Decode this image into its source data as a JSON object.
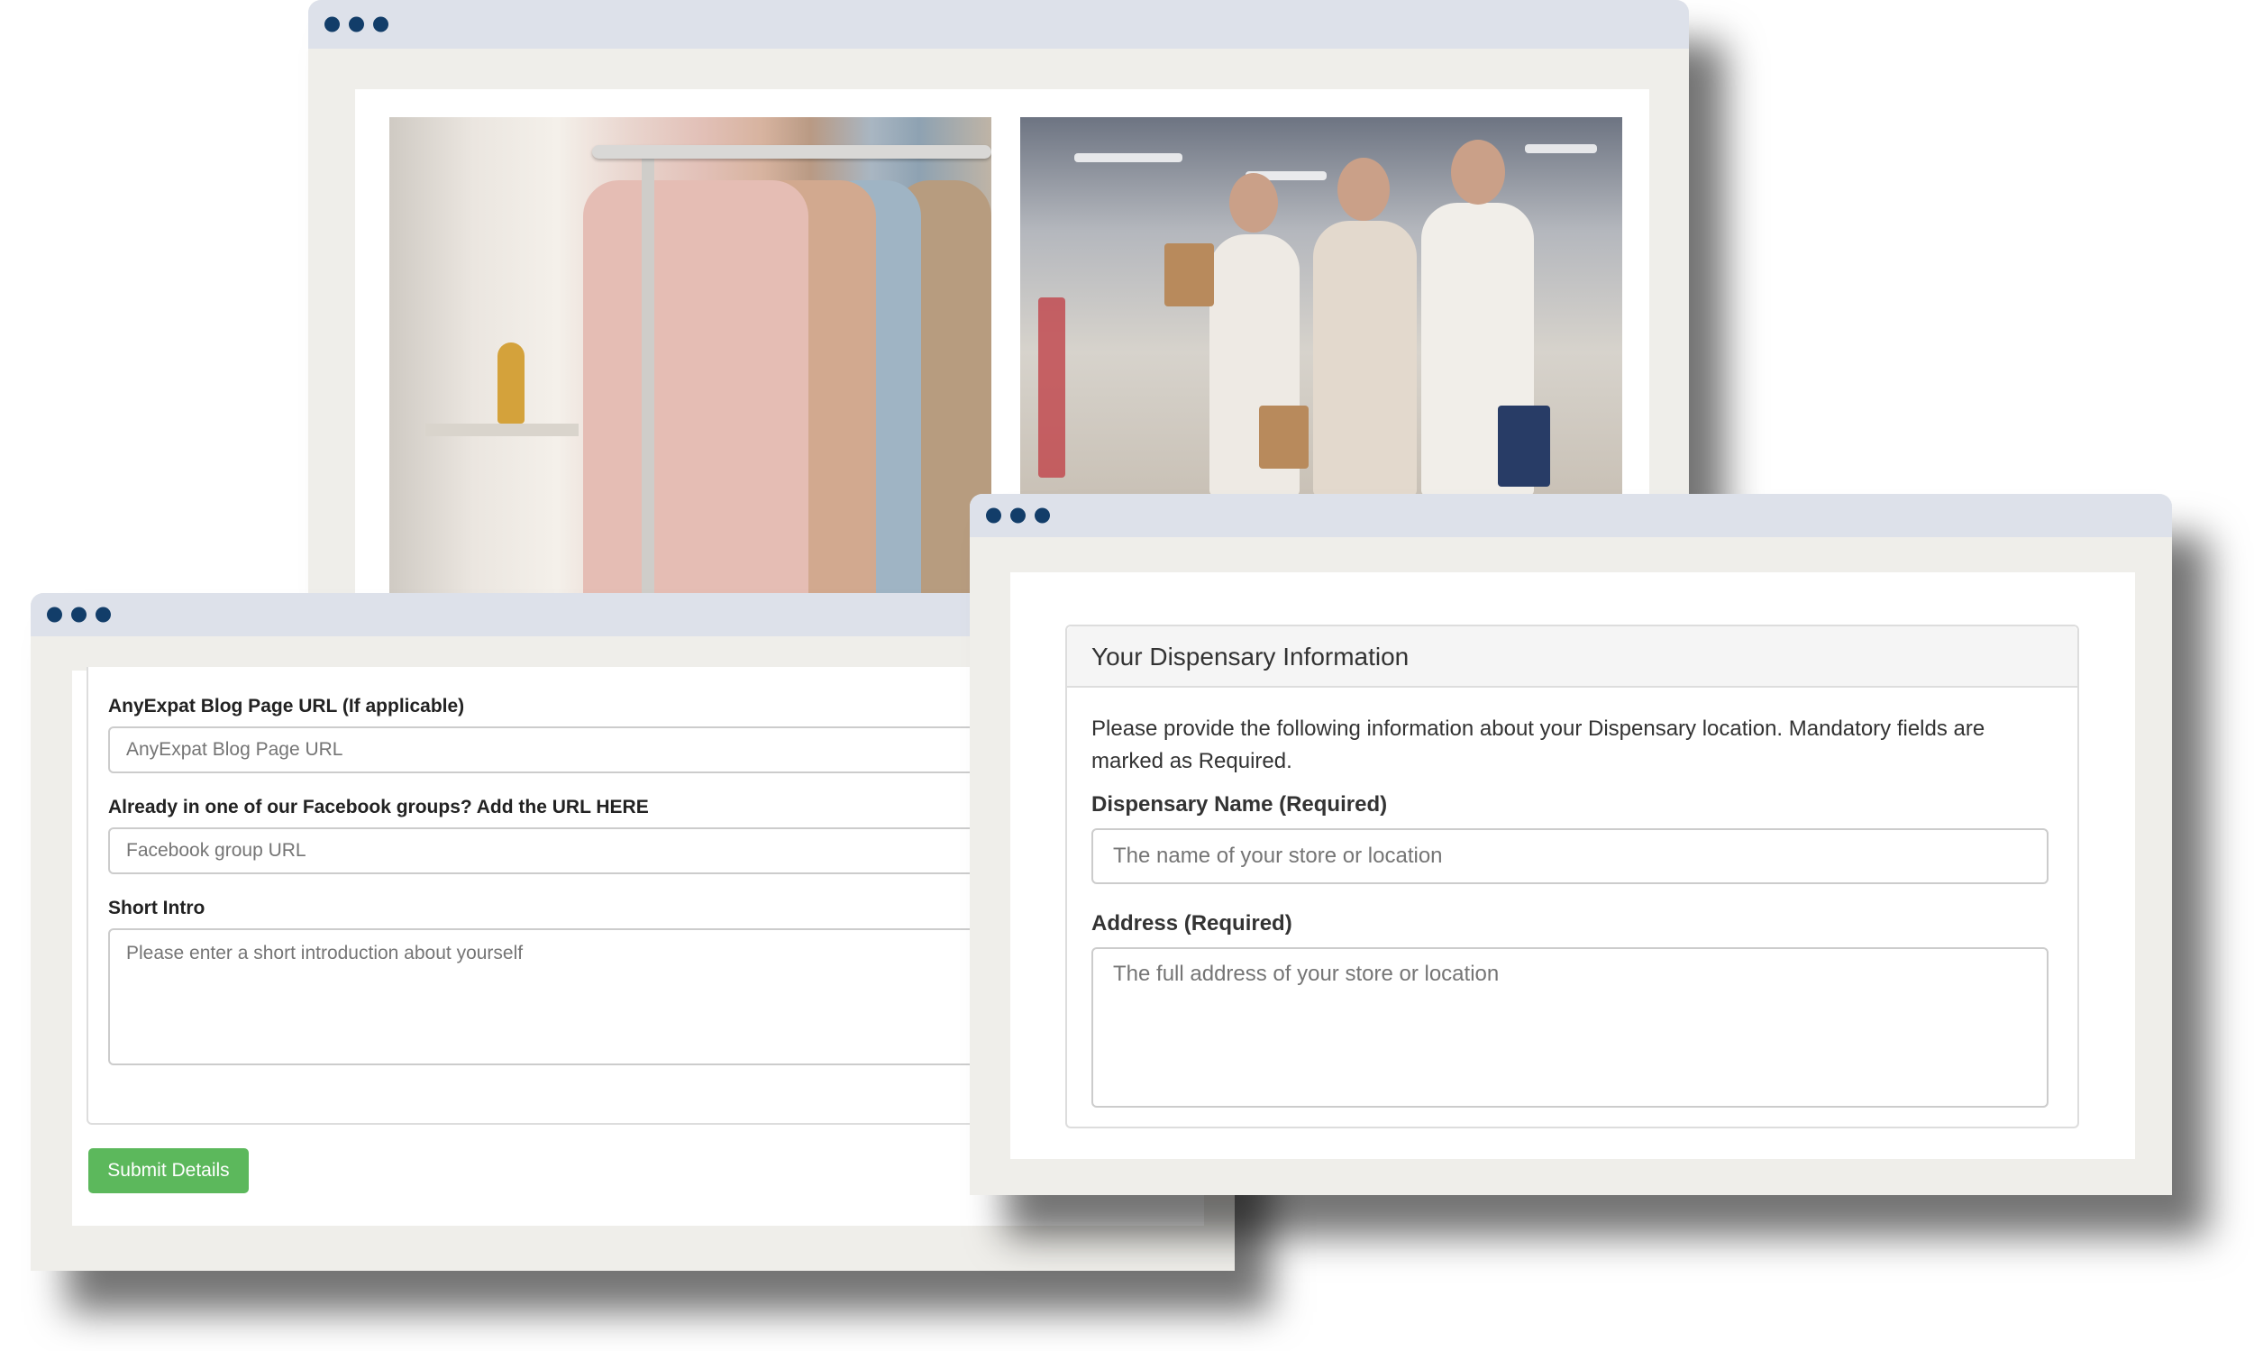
{
  "photo_window": {
    "images": [
      {
        "name": "clothing-rack-photo"
      },
      {
        "name": "mall-shoppers-photo"
      }
    ]
  },
  "profile_form": {
    "blog_url": {
      "label": "AnyExpat Blog Page URL (If applicable)",
      "placeholder": "AnyExpat Blog Page URL",
      "value": ""
    },
    "facebook_url": {
      "label": "Already in one of our Facebook groups? Add the URL HERE",
      "placeholder": "Facebook group URL",
      "value": ""
    },
    "short_intro": {
      "label": "Short Intro",
      "placeholder": "Please enter a short introduction about yourself",
      "value": ""
    },
    "submit_label": "Submit Details"
  },
  "dispensary_form": {
    "title": "Your Dispensary Information",
    "description": "Please provide the following information about your Dispensary location. Mandatory fields are marked as Required.",
    "name_field": {
      "label": "Dispensary Name (Required)",
      "placeholder": "The name of your store or location",
      "value": ""
    },
    "address_field": {
      "label": "Address (Required)",
      "placeholder": "The full address of your store or location",
      "value": ""
    }
  },
  "colors": {
    "titlebar": "#dde1ea",
    "window_dots": "#123d69",
    "window_frame": "#efeeea",
    "submit_button": "#5cb85c"
  }
}
